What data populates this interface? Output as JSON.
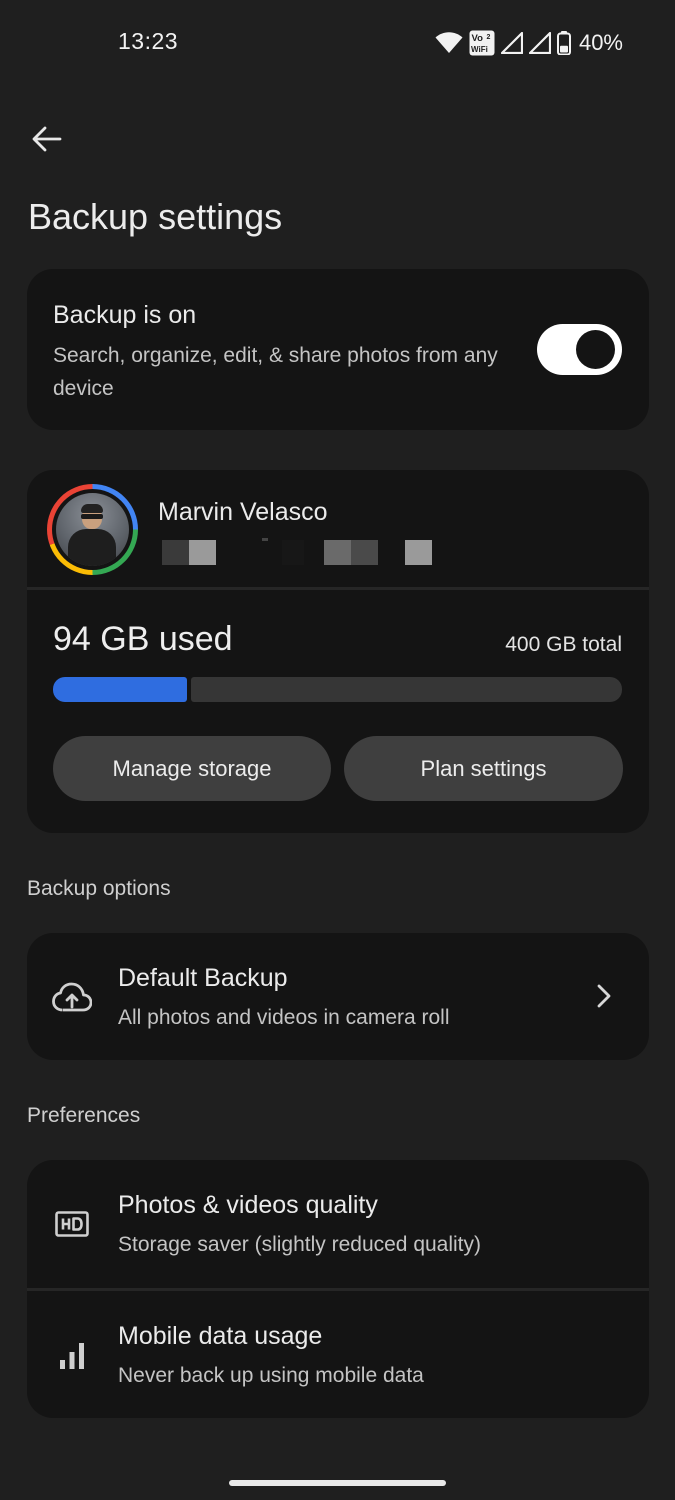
{
  "status_bar": {
    "time": "13:23",
    "volte_label_top": "Vo",
    "volte_label_bottom": "WiFi",
    "volte_label_num": "2",
    "battery_percent": "40%",
    "battery_level": 0.4
  },
  "header": {
    "title": "Backup settings"
  },
  "backup_card": {
    "title": "Backup is on",
    "subtitle": "Search, organize, edit, & share photos from any device",
    "toggle_on": true
  },
  "account": {
    "name": "Marvin Velasco",
    "used_label": "94 GB used",
    "total_label": "400 GB total",
    "usage_fraction": 0.235,
    "manage_button": "Manage storage",
    "plan_button": "Plan settings"
  },
  "backup_options": {
    "section_title": "Backup options",
    "default_backup": {
      "title": "Default Backup",
      "subtitle": "All photos and videos in camera roll",
      "icon": "cloud-upload-icon"
    }
  },
  "preferences": {
    "section_title": "Preferences",
    "items": [
      {
        "title": "Photos & videos quality",
        "subtitle": "Storage saver (slightly reduced quality)",
        "icon": "hd-icon"
      },
      {
        "title": "Mobile data usage",
        "subtitle": "Never back up using mobile data",
        "icon": "signal-bars-icon"
      }
    ]
  },
  "colors": {
    "background": "#1f1f1f",
    "card": "#141414",
    "accent_blue": "#2f6de0",
    "button": "#3f3f3f"
  }
}
